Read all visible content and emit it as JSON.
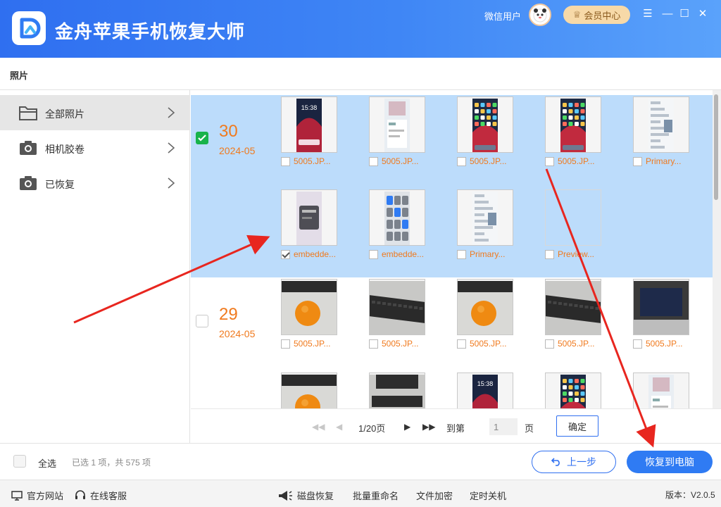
{
  "header": {
    "app_title": "金舟苹果手机恢复大师",
    "user_name": "微信用户",
    "member_label": "会员中心",
    "win_controls": [
      "☰",
      "—",
      "☐",
      "✕"
    ]
  },
  "breadcrumb": "照片",
  "sidebar": {
    "items": [
      {
        "label": "全部照片",
        "icon": "folder-icon"
      },
      {
        "label": "相机胶卷",
        "icon": "camera-icon"
      },
      {
        "label": "已恢复",
        "icon": "camera-icon"
      }
    ]
  },
  "groups": [
    {
      "day": "30",
      "date": "2024-05",
      "checked": true,
      "rows": [
        [
          {
            "name": "5005.JP...",
            "checked": false,
            "img": "phone-lock"
          },
          {
            "name": "5005.JP...",
            "checked": false,
            "img": "phone-app"
          },
          {
            "name": "5005.JP...",
            "checked": false,
            "img": "phone-home"
          },
          {
            "name": "5005.JP...",
            "checked": false,
            "img": "phone-home"
          },
          {
            "name": "Primary...",
            "checked": false,
            "img": "doc"
          }
        ],
        [
          {
            "name": "embedde...",
            "checked": true,
            "img": "blur"
          },
          {
            "name": "embedde...",
            "checked": false,
            "img": "control"
          },
          {
            "name": "Primary...",
            "checked": false,
            "img": "doc"
          },
          {
            "name": "Preview...",
            "checked": false,
            "img": "empty"
          }
        ]
      ]
    },
    {
      "day": "29",
      "date": "2024-05",
      "checked": false,
      "rows": [
        [
          {
            "name": "5005.JP...",
            "checked": false,
            "img": "orange"
          },
          {
            "name": "5005.JP...",
            "checked": false,
            "img": "keyboard"
          },
          {
            "name": "5005.JP...",
            "checked": false,
            "img": "orange"
          },
          {
            "name": "5005.JP...",
            "checked": false,
            "img": "keyboard"
          },
          {
            "name": "5005.JP...",
            "checked": false,
            "img": "keyboard-dark"
          }
        ],
        [
          {
            "name": "",
            "checked": false,
            "img": "orange"
          },
          {
            "name": "",
            "checked": false,
            "img": "monitor"
          },
          {
            "name": "",
            "checked": false,
            "img": "phone-lock"
          },
          {
            "name": "",
            "checked": false,
            "img": "phone-home"
          },
          {
            "name": "",
            "checked": false,
            "img": "phone-app"
          }
        ]
      ]
    }
  ],
  "lock_time": "15:38",
  "pager": {
    "page_info": "1/20页",
    "goto_label": "到第",
    "goto_value": "1",
    "page_unit": "页",
    "confirm": "确定"
  },
  "actions": {
    "select_all": "全选",
    "selection_info": "已选 1 项，共 575 项",
    "prev": "上一步",
    "recover": "恢复到电脑"
  },
  "footer": {
    "website": "官方网站",
    "support": "在线客服",
    "disk_recovery": "磁盘恢复",
    "batch_rename": "批量重命名",
    "file_encrypt": "文件加密",
    "shutdown": "定时关机",
    "version": "版本：V2.0.5"
  },
  "colors": {
    "accent": "#2f7bf3",
    "orange": "#f07a1e",
    "selection_bg": "#bcdcfb",
    "check_green": "#19b34a",
    "arrow_red": "#e8261f"
  }
}
